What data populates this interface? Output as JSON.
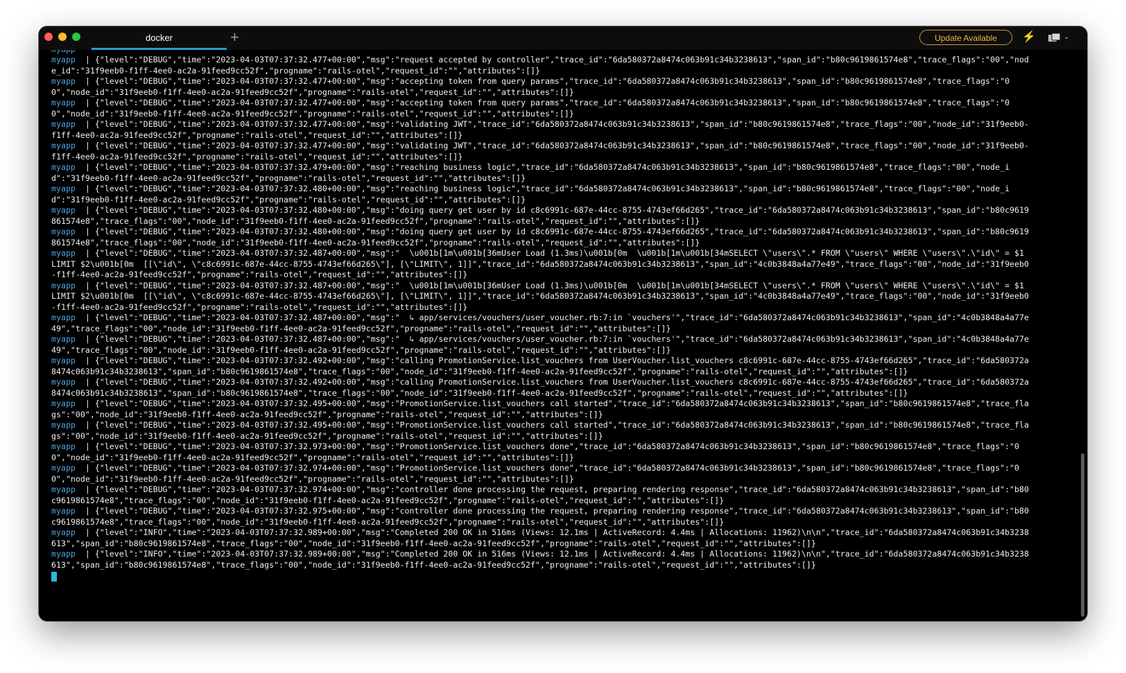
{
  "window": {
    "tab_title": "docker",
    "new_tab_symbol": "+",
    "update_label": "Update Available",
    "bolt_icon": "⚡",
    "chevron_icon": "⌄"
  },
  "terminal": {
    "service": "myapp",
    "separator": "  | ",
    "lines": [
      "{\"level\":\"DEBUG\",\"time\":\"2023-04-03T07:37:32.477+00:00\",\"msg\":\"request accepted by controller\",\"trace_id\":\"6da580372a8474c063b91c34b3238613\",\"span_id\":\"b80c9619861574e8\",\"trace_flags\":\"00\",\"node_id\":\"31f9eeb0-f1ff-4ee0-ac2a-91feed9cc52f\",\"progname\":\"rails-otel\",\"request_id\":\"\",\"attributes\":[]}",
      "{\"level\":\"DEBUG\",\"time\":\"2023-04-03T07:37:32.477+00:00\",\"msg\":\"accepting token from query params\",\"trace_id\":\"6da580372a8474c063b91c34b3238613\",\"span_id\":\"b80c9619861574e8\",\"trace_flags\":\"00\",\"node_id\":\"31f9eeb0-f1ff-4ee0-ac2a-91feed9cc52f\",\"progname\":\"rails-otel\",\"request_id\":\"\",\"attributes\":[]}",
      "{\"level\":\"DEBUG\",\"time\":\"2023-04-03T07:37:32.477+00:00\",\"msg\":\"accepting token from query params\",\"trace_id\":\"6da580372a8474c063b91c34b3238613\",\"span_id\":\"b80c9619861574e8\",\"trace_flags\":\"00\",\"node_id\":\"31f9eeb0-f1ff-4ee0-ac2a-91feed9cc52f\",\"progname\":\"rails-otel\",\"request_id\":\"\",\"attributes\":[]}",
      "{\"level\":\"DEBUG\",\"time\":\"2023-04-03T07:37:32.477+00:00\",\"msg\":\"validating JWT\",\"trace_id\":\"6da580372a8474c063b91c34b3238613\",\"span_id\":\"b80c9619861574e8\",\"trace_flags\":\"00\",\"node_id\":\"31f9eeb0-f1ff-4ee0-ac2a-91feed9cc52f\",\"progname\":\"rails-otel\",\"request_id\":\"\",\"attributes\":[]}",
      "{\"level\":\"DEBUG\",\"time\":\"2023-04-03T07:37:32.477+00:00\",\"msg\":\"validating JWT\",\"trace_id\":\"6da580372a8474c063b91c34b3238613\",\"span_id\":\"b80c9619861574e8\",\"trace_flags\":\"00\",\"node_id\":\"31f9eeb0-f1ff-4ee0-ac2a-91feed9cc52f\",\"progname\":\"rails-otel\",\"request_id\":\"\",\"attributes\":[]}",
      "{\"level\":\"DEBUG\",\"time\":\"2023-04-03T07:37:32.479+00:00\",\"msg\":\"reaching business logic\",\"trace_id\":\"6da580372a8474c063b91c34b3238613\",\"span_id\":\"b80c9619861574e8\",\"trace_flags\":\"00\",\"node_id\":\"31f9eeb0-f1ff-4ee0-ac2a-91feed9cc52f\",\"progname\":\"rails-otel\",\"request_id\":\"\",\"attributes\":[]}",
      "{\"level\":\"DEBUG\",\"time\":\"2023-04-03T07:37:32.480+00:00\",\"msg\":\"reaching business logic\",\"trace_id\":\"6da580372a8474c063b91c34b3238613\",\"span_id\":\"b80c9619861574e8\",\"trace_flags\":\"00\",\"node_id\":\"31f9eeb0-f1ff-4ee0-ac2a-91feed9cc52f\",\"progname\":\"rails-otel\",\"request_id\":\"\",\"attributes\":[]}",
      "{\"level\":\"DEBUG\",\"time\":\"2023-04-03T07:37:32.480+00:00\",\"msg\":\"doing query get user by id c8c6991c-687e-44cc-8755-4743ef66d265\",\"trace_id\":\"6da580372a8474c063b91c34b3238613\",\"span_id\":\"b80c9619861574e8\",\"trace_flags\":\"00\",\"node_id\":\"31f9eeb0-f1ff-4ee0-ac2a-91feed9cc52f\",\"progname\":\"rails-otel\",\"request_id\":\"\",\"attributes\":[]}",
      "{\"level\":\"DEBUG\",\"time\":\"2023-04-03T07:37:32.480+00:00\",\"msg\":\"doing query get user by id c8c6991c-687e-44cc-8755-4743ef66d265\",\"trace_id\":\"6da580372a8474c063b91c34b3238613\",\"span_id\":\"b80c9619861574e8\",\"trace_flags\":\"00\",\"node_id\":\"31f9eeb0-f1ff-4ee0-ac2a-91feed9cc52f\",\"progname\":\"rails-otel\",\"request_id\":\"\",\"attributes\":[]}",
      "{\"level\":\"DEBUG\",\"time\":\"2023-04-03T07:37:32.487+00:00\",\"msg\":\"  \\u001b[1m\\u001b[36mUser Load (1.3ms)\\u001b[0m  \\u001b[1m\\u001b[34mSELECT \\\"users\\\".* FROM \\\"users\\\" WHERE \\\"users\\\".\\\"id\\\" = $1 LIMIT $2\\u001b[0m  [[\\\"id\\\", \\\"c8c6991c-687e-44cc-8755-4743ef66d265\\\"], [\\\"LIMIT\\\", 1]]\",\"trace_id\":\"6da580372a8474c063b91c34b3238613\",\"span_id\":\"4c0b3848a4a77e49\",\"trace_flags\":\"00\",\"node_id\":\"31f9eeb0-f1ff-4ee0-ac2a-91feed9cc52f\",\"progname\":\"rails-otel\",\"request_id\":\"\",\"attributes\":[]}",
      "{\"level\":\"DEBUG\",\"time\":\"2023-04-03T07:37:32.487+00:00\",\"msg\":\"  \\u001b[1m\\u001b[36mUser Load (1.3ms)\\u001b[0m  \\u001b[1m\\u001b[34mSELECT \\\"users\\\".* FROM \\\"users\\\" WHERE \\\"users\\\".\\\"id\\\" = $1 LIMIT $2\\u001b[0m  [[\\\"id\\\", \\\"c8c6991c-687e-44cc-8755-4743ef66d265\\\"], [\\\"LIMIT\\\", 1]]\",\"trace_id\":\"6da580372a8474c063b91c34b3238613\",\"span_id\":\"4c0b3848a4a77e49\",\"trace_flags\":\"00\",\"node_id\":\"31f9eeb0-f1ff-4ee0-ac2a-91feed9cc52f\",\"progname\":\"rails-otel\",\"request_id\":\"\",\"attributes\":[]}",
      "{\"level\":\"DEBUG\",\"time\":\"2023-04-03T07:37:32.487+00:00\",\"msg\":\"  ↳ app/services/vouchers/user_voucher.rb:7:in `vouchers'\",\"trace_id\":\"6da580372a8474c063b91c34b3238613\",\"span_id\":\"4c0b3848a4a77e49\",\"trace_flags\":\"00\",\"node_id\":\"31f9eeb0-f1ff-4ee0-ac2a-91feed9cc52f\",\"progname\":\"rails-otel\",\"request_id\":\"\",\"attributes\":[]}",
      "{\"level\":\"DEBUG\",\"time\":\"2023-04-03T07:37:32.487+00:00\",\"msg\":\"  ↳ app/services/vouchers/user_voucher.rb:7:in `vouchers'\",\"trace_id\":\"6da580372a8474c063b91c34b3238613\",\"span_id\":\"4c0b3848a4a77e49\",\"trace_flags\":\"00\",\"node_id\":\"31f9eeb0-f1ff-4ee0-ac2a-91feed9cc52f\",\"progname\":\"rails-otel\",\"request_id\":\"\",\"attributes\":[]}",
      "{\"level\":\"DEBUG\",\"time\":\"2023-04-03T07:37:32.492+00:00\",\"msg\":\"calling PromotionService.list_vouchers from UserVoucher.list_vouchers c8c6991c-687e-44cc-8755-4743ef66d265\",\"trace_id\":\"6da580372a8474c063b91c34b3238613\",\"span_id\":\"b80c9619861574e8\",\"trace_flags\":\"00\",\"node_id\":\"31f9eeb0-f1ff-4ee0-ac2a-91feed9cc52f\",\"progname\":\"rails-otel\",\"request_id\":\"\",\"attributes\":[]}",
      "{\"level\":\"DEBUG\",\"time\":\"2023-04-03T07:37:32.492+00:00\",\"msg\":\"calling PromotionService.list_vouchers from UserVoucher.list_vouchers c8c6991c-687e-44cc-8755-4743ef66d265\",\"trace_id\":\"6da580372a8474c063b91c34b3238613\",\"span_id\":\"b80c9619861574e8\",\"trace_flags\":\"00\",\"node_id\":\"31f9eeb0-f1ff-4ee0-ac2a-91feed9cc52f\",\"progname\":\"rails-otel\",\"request_id\":\"\",\"attributes\":[]}",
      "{\"level\":\"DEBUG\",\"time\":\"2023-04-03T07:37:32.495+00:00\",\"msg\":\"PromotionService.list_vouchers call started\",\"trace_id\":\"6da580372a8474c063b91c34b3238613\",\"span_id\":\"b80c9619861574e8\",\"trace_flags\":\"00\",\"node_id\":\"31f9eeb0-f1ff-4ee0-ac2a-91feed9cc52f\",\"progname\":\"rails-otel\",\"request_id\":\"\",\"attributes\":[]}",
      "{\"level\":\"DEBUG\",\"time\":\"2023-04-03T07:37:32.495+00:00\",\"msg\":\"PromotionService.list_vouchers call started\",\"trace_id\":\"6da580372a8474c063b91c34b3238613\",\"span_id\":\"b80c9619861574e8\",\"trace_flags\":\"00\",\"node_id\":\"31f9eeb0-f1ff-4ee0-ac2a-91feed9cc52f\",\"progname\":\"rails-otel\",\"request_id\":\"\",\"attributes\":[]}",
      "{\"level\":\"DEBUG\",\"time\":\"2023-04-03T07:37:32.973+00:00\",\"msg\":\"PromotionService.list_vouchers done\",\"trace_id\":\"6da580372a8474c063b91c34b3238613\",\"span_id\":\"b80c9619861574e8\",\"trace_flags\":\"00\",\"node_id\":\"31f9eeb0-f1ff-4ee0-ac2a-91feed9cc52f\",\"progname\":\"rails-otel\",\"request_id\":\"\",\"attributes\":[]}",
      "{\"level\":\"DEBUG\",\"time\":\"2023-04-03T07:37:32.974+00:00\",\"msg\":\"PromotionService.list_vouchers done\",\"trace_id\":\"6da580372a8474c063b91c34b3238613\",\"span_id\":\"b80c9619861574e8\",\"trace_flags\":\"00\",\"node_id\":\"31f9eeb0-f1ff-4ee0-ac2a-91feed9cc52f\",\"progname\":\"rails-otel\",\"request_id\":\"\",\"attributes\":[]}",
      "{\"level\":\"DEBUG\",\"time\":\"2023-04-03T07:37:32.974+00:00\",\"msg\":\"controller done processing the request, preparing rendering response\",\"trace_id\":\"6da580372a8474c063b91c34b3238613\",\"span_id\":\"b80c9619861574e8\",\"trace_flags\":\"00\",\"node_id\":\"31f9eeb0-f1ff-4ee0-ac2a-91feed9cc52f\",\"progname\":\"rails-otel\",\"request_id\":\"\",\"attributes\":[]}",
      "{\"level\":\"DEBUG\",\"time\":\"2023-04-03T07:37:32.975+00:00\",\"msg\":\"controller done processing the request, preparing rendering response\",\"trace_id\":\"6da580372a8474c063b91c34b3238613\",\"span_id\":\"b80c9619861574e8\",\"trace_flags\":\"00\",\"node_id\":\"31f9eeb0-f1ff-4ee0-ac2a-91feed9cc52f\",\"progname\":\"rails-otel\",\"request_id\":\"\",\"attributes\":[]}",
      "{\"level\":\"INFO\",\"time\":\"2023-04-03T07:37:32.989+00:00\",\"msg\":\"Completed 200 OK in 516ms (Views: 12.1ms | ActiveRecord: 4.4ms | Allocations: 11962)\\n\\n\",\"trace_id\":\"6da580372a8474c063b91c34b3238613\",\"span_id\":\"b80c9619861574e8\",\"trace_flags\":\"00\",\"node_id\":\"31f9eeb0-f1ff-4ee0-ac2a-91feed9cc52f\",\"progname\":\"rails-otel\",\"request_id\":\"\",\"attributes\":[]}",
      "{\"level\":\"INFO\",\"time\":\"2023-04-03T07:37:32.989+00:00\",\"msg\":\"Completed 200 OK in 516ms (Views: 12.1ms | ActiveRecord: 4.4ms | Allocations: 11962)\\n\\n\",\"trace_id\":\"6da580372a8474c063b91c34b3238613\",\"span_id\":\"b80c9619861574e8\",\"trace_flags\":\"00\",\"node_id\":\"31f9eeb0-f1ff-4ee0-ac2a-91feed9cc52f\",\"progname\":\"rails-otel\",\"request_id\":\"\",\"attributes\":[]}"
    ]
  }
}
